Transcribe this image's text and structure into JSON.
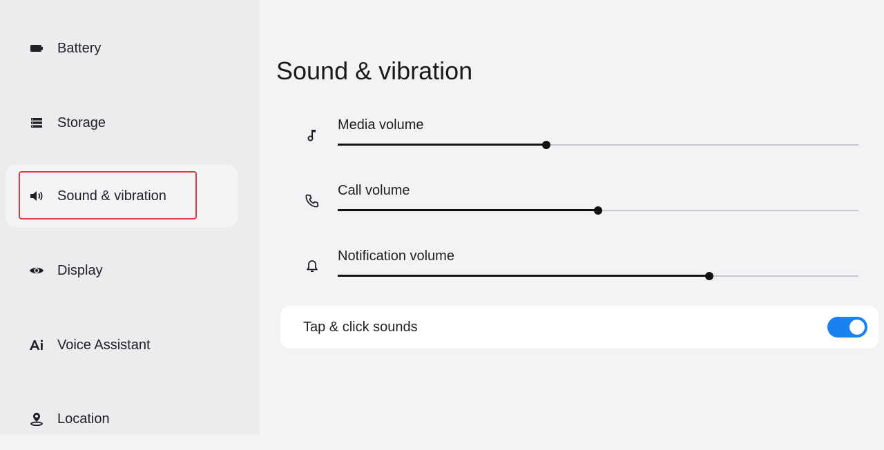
{
  "sidebar": {
    "items": [
      {
        "label": "Battery",
        "icon": "battery-icon"
      },
      {
        "label": "Storage",
        "icon": "storage-icon"
      },
      {
        "label": "Sound & vibration",
        "icon": "speaker-icon",
        "selected": true
      },
      {
        "label": "Display",
        "icon": "eye-icon"
      },
      {
        "label": "Voice Assistant",
        "icon": "ai-icon"
      },
      {
        "label": "Location",
        "icon": "location-pin-icon"
      }
    ]
  },
  "main": {
    "title": "Sound & vibration",
    "volumes": [
      {
        "label": "Media volume",
        "icon": "music-note-icon",
        "level": 0.4
      },
      {
        "label": "Call volume",
        "icon": "phone-icon",
        "level": 0.5
      },
      {
        "label": "Notification volume",
        "icon": "bell-icon",
        "level": 0.714
      }
    ],
    "tap_click": {
      "label": "Tap & click sounds",
      "enabled": true
    }
  },
  "colors": {
    "accent": "#1a82f0",
    "highlight": "#e2383f"
  }
}
